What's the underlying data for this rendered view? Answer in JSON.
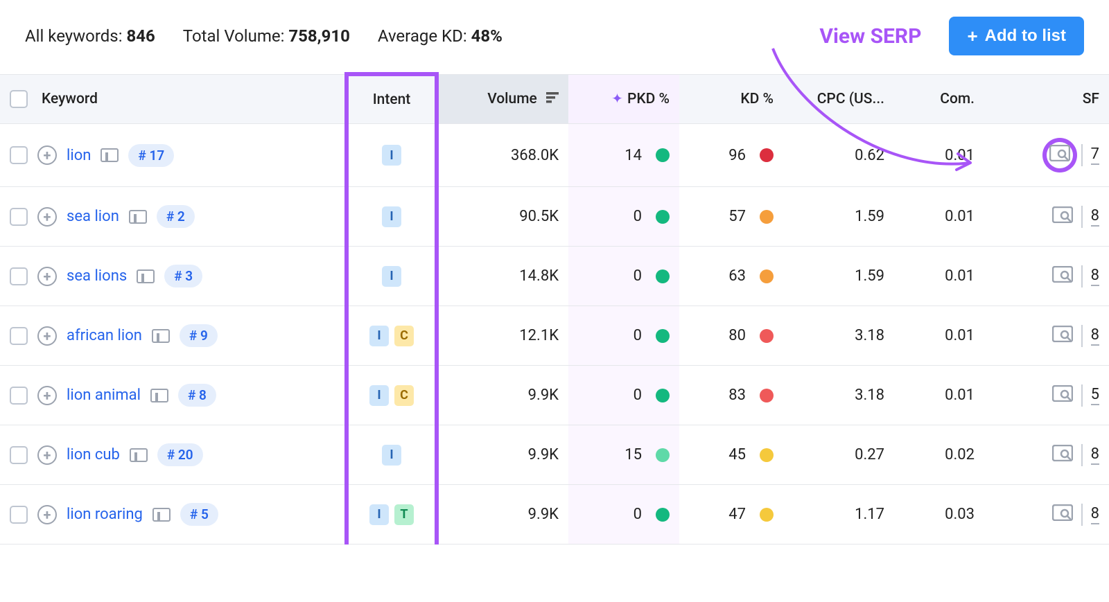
{
  "summary": {
    "all_keywords_label": "All keywords:",
    "all_keywords_value": "846",
    "total_volume_label": "Total Volume:",
    "total_volume_value": "758,910",
    "avg_kd_label": "Average KD:",
    "avg_kd_value": "48%"
  },
  "callout": "View SERP",
  "add_btn": "Add to list",
  "columns": {
    "keyword": "Keyword",
    "intent": "Intent",
    "volume": "Volume",
    "pkd": "PKD %",
    "kd": "KD %",
    "cpc": "CPC (US...",
    "com": "Com.",
    "sf": "SF"
  },
  "rows": [
    {
      "keyword": "lion",
      "pos": "# 17",
      "intents": [
        "I"
      ],
      "volume": "368.0K",
      "pkd": "14",
      "pkd_color": "#14b87f",
      "kd": "96",
      "kd_color": "#dc2e3e",
      "cpc": "0.62",
      "com": "0.01",
      "sf": "7",
      "serp_highlight": true
    },
    {
      "keyword": "sea lion",
      "pos": "# 2",
      "intents": [
        "I"
      ],
      "volume": "90.5K",
      "pkd": "0",
      "pkd_color": "#14b87f",
      "kd": "57",
      "kd_color": "#f59e3c",
      "cpc": "1.59",
      "com": "0.01",
      "sf": "8",
      "serp_highlight": false
    },
    {
      "keyword": "sea lions",
      "pos": "# 3",
      "intents": [
        "I"
      ],
      "volume": "14.8K",
      "pkd": "0",
      "pkd_color": "#14b87f",
      "kd": "63",
      "kd_color": "#f59e3c",
      "cpc": "1.59",
      "com": "0.01",
      "sf": "8",
      "serp_highlight": false
    },
    {
      "keyword": "african lion",
      "pos": "# 9",
      "intents": [
        "I",
        "C"
      ],
      "volume": "12.1K",
      "pkd": "0",
      "pkd_color": "#14b87f",
      "kd": "80",
      "kd_color": "#ef5959",
      "cpc": "3.18",
      "com": "0.01",
      "sf": "8",
      "serp_highlight": false
    },
    {
      "keyword": "lion animal",
      "pos": "# 8",
      "intents": [
        "I",
        "C"
      ],
      "volume": "9.9K",
      "pkd": "0",
      "pkd_color": "#14b87f",
      "kd": "83",
      "kd_color": "#ef5959",
      "cpc": "3.18",
      "com": "0.01",
      "sf": "5",
      "serp_highlight": false
    },
    {
      "keyword": "lion cub",
      "pos": "# 20",
      "intents": [
        "I"
      ],
      "volume": "9.9K",
      "pkd": "15",
      "pkd_color": "#5fd9a8",
      "kd": "45",
      "kd_color": "#f5c93c",
      "cpc": "0.27",
      "com": "0.02",
      "sf": "8",
      "serp_highlight": false
    },
    {
      "keyword": "lion roaring",
      "pos": "# 5",
      "intents": [
        "I",
        "T"
      ],
      "volume": "9.9K",
      "pkd": "0",
      "pkd_color": "#14b87f",
      "kd": "47",
      "kd_color": "#f5c93c",
      "cpc": "1.17",
      "com": "0.03",
      "sf": "8",
      "serp_highlight": false
    }
  ]
}
